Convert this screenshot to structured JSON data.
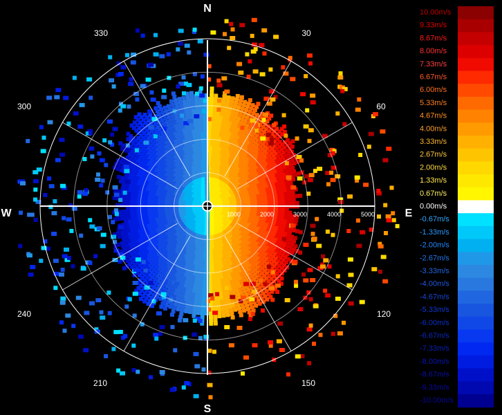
{
  "compass": {
    "north": "N",
    "east": "E",
    "south": "S",
    "west": "W"
  },
  "bearings": [
    "30",
    "60",
    "120",
    "150",
    "210",
    "240",
    "300",
    "330"
  ],
  "range_labels": [
    "1000",
    "2000",
    "3000",
    "4000",
    "5000"
  ],
  "legend": {
    "labels": [
      "10.00m/s",
      "9.33m/s",
      "8.67m/s",
      "8.00m/s",
      "7.33m/s",
      "6.67m/s",
      "6.00m/s",
      "5.33m/s",
      "4.67m/s",
      "4.00m/s",
      "3.33m/s",
      "2.67m/s",
      "2.00m/s",
      "1.33m/s",
      "0.67m/s",
      "0.00m/s",
      "-0.67m/s",
      "-1.33m/s",
      "-2.00m/s",
      "-2.67m/s",
      "-3.33m/s",
      "-4.00m/s",
      "-4.67m/s",
      "-5.33m/s",
      "-6.00m/s",
      "-6.67m/s",
      "-7.33m/s",
      "-8.00m/s",
      "-8.67m/s",
      "-9.33m/s",
      "-10.00m/s"
    ],
    "colors": [
      "#8b0000",
      "#a80000",
      "#c40000",
      "#dc0000",
      "#f00a00",
      "#ff2a00",
      "#ff4a00",
      "#ff6a00",
      "#ff8200",
      "#ff9a00",
      "#ffb000",
      "#ffc400",
      "#ffd800",
      "#ffe800",
      "#fff600",
      "#ffffff",
      "#00e0ff",
      "#00c8f8",
      "#00b0f0",
      "#2098e8",
      "#2c88e0",
      "#2878e0",
      "#2066e0",
      "#1856e0",
      "#1048e8",
      "#0838f0",
      "#0028f0",
      "#001ce0",
      "#0010c8",
      "#0008b0",
      "#000090"
    ],
    "label_colors": [
      "#c00000",
      "#e00000",
      "#ff1a1a",
      "#ff3030",
      "#ff4040",
      "#ff5a2a",
      "#ff7020",
      "#ff8020",
      "#ff9020",
      "#ffa030",
      "#ffb830",
      "#ffc840",
      "#ffd840",
      "#ffe850",
      "#fff060",
      "#ffffff",
      "#30a8ff",
      "#2898ff",
      "#2088ff",
      "#2078f0",
      "#2068e8",
      "#2058e0",
      "#1848d8",
      "#1038d0",
      "#0830c8",
      "#0828c0",
      "#0820b8",
      "#0818b0",
      "#0810a8",
      "#0808a0",
      "#080898"
    ]
  },
  "colors": {
    "background": "#000000",
    "rings": "#ffffff",
    "axes": "#ffffff"
  }
}
